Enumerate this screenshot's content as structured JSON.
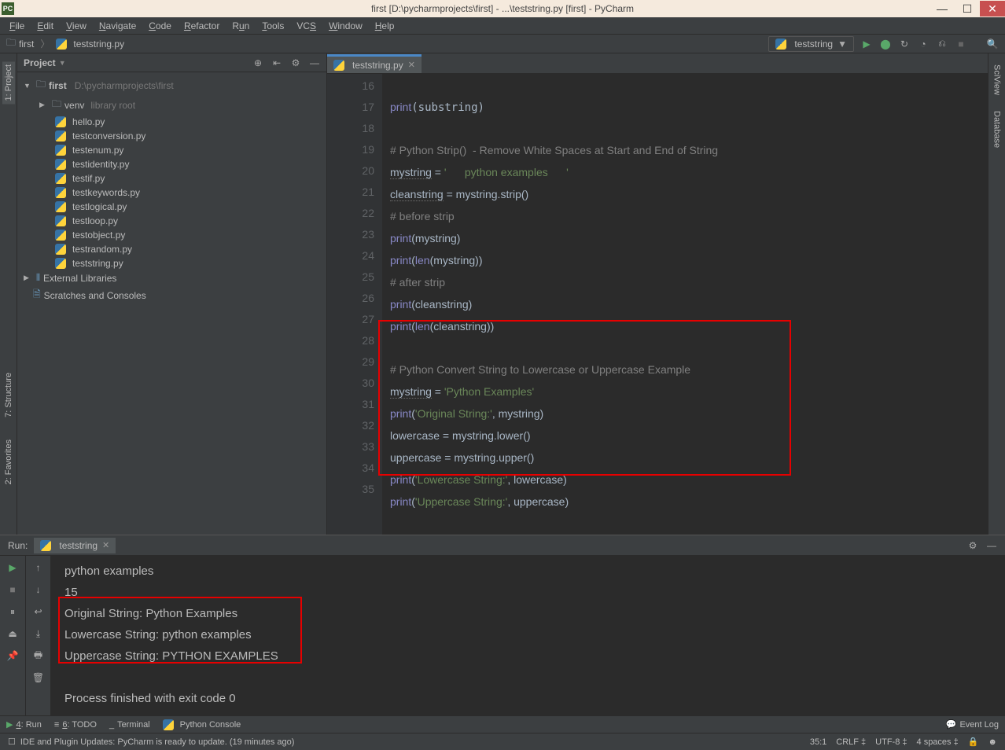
{
  "window": {
    "title": "first [D:\\pycharmprojects\\first] - ...\\teststring.py [first] - PyCharm"
  },
  "menubar": {
    "file": "File",
    "edit": "Edit",
    "view": "View",
    "navigate": "Navigate",
    "code": "Code",
    "refactor": "Refactor",
    "run": "Run",
    "tools": "Tools",
    "vcs": "VCS",
    "window": "Window",
    "help": "Help"
  },
  "breadcrumb": {
    "root": "first",
    "file": "teststring.py"
  },
  "run_config": {
    "name": "teststring"
  },
  "left_tabs": {
    "project": "1: Project",
    "structure": "7: Structure",
    "favorites": "2: Favorites"
  },
  "right_tabs": {
    "sciview": "SciView",
    "database": "Database"
  },
  "project_panel": {
    "title": "Project",
    "root": "first",
    "root_path": "D:\\pycharmprojects\\first",
    "venv": "venv",
    "venv_desc": "library root",
    "files": [
      "hello.py",
      "testconversion.py",
      "testenum.py",
      "testidentity.py",
      "testif.py",
      "testkeywords.py",
      "testlogical.py",
      "testloop.py",
      "testobject.py",
      "testrandom.py",
      "teststring.py"
    ],
    "ext_libs": "External Libraries",
    "scratches": "Scratches and Consoles"
  },
  "editor": {
    "tab": "teststring.py",
    "lines": {
      "16": "print(substring)",
      "17": "",
      "18": "# Python Strip()  - Remove White Spaces at Start and End of String",
      "19a": "mystring",
      "19b": " = ",
      "19c": "'      python examples      '",
      "20a": "cleanstring",
      "20b": " = mystring.strip()",
      "21": "# before strip",
      "22a": "print",
      "22b": "(mystring)",
      "23a": "print",
      "23b": "(",
      "23c": "len",
      "23d": "(mystring))",
      "24": "# after strip",
      "25a": "print",
      "25b": "(cleanstring)",
      "26a": "print",
      "26b": "(",
      "26c": "len",
      "26d": "(cleanstring))",
      "27": "",
      "28": "# Python Convert String to Lowercase or Uppercase Example",
      "29a": "mystring",
      "29b": " = ",
      "29c": "'Python Examples'",
      "30a": "print",
      "30b": "(",
      "30c": "'Original String:'",
      "30d": ", mystring)",
      "31": "lowercase = mystring.lower()",
      "32": "uppercase = mystring.upper()",
      "33a": "print",
      "33b": "(",
      "33c": "'Lowercase String:'",
      "33d": ", lowercase)",
      "34a": "print",
      "34b": "(",
      "34c": "'Uppercase String:'",
      "34d": ", uppercase)"
    },
    "line_nums": [
      "16",
      "17",
      "18",
      "19",
      "20",
      "21",
      "22",
      "23",
      "24",
      "25",
      "26",
      "27",
      "28",
      "29",
      "30",
      "31",
      "32",
      "33",
      "34",
      "35"
    ]
  },
  "run_panel": {
    "label": "Run:",
    "tab": "teststring",
    "out1": "  python examples",
    "out2": "15",
    "out3": "Original String: Python Examples",
    "out4": "Lowercase String: python examples",
    "out5": "Uppercase String: PYTHON EXAMPLES",
    "out6": "Process finished with exit code 0"
  },
  "bottombar": {
    "run": "4: Run",
    "todo": "6: TODO",
    "terminal": "Terminal",
    "pyconsole": "Python Console",
    "eventlog": "Event Log"
  },
  "statusbar": {
    "msg": "IDE and Plugin Updates: PyCharm is ready to update. (19 minutes ago)",
    "pos": "35:1",
    "eol": "CRLF ‡",
    "enc": "UTF-8 ‡",
    "indent": "4 spaces ‡"
  }
}
